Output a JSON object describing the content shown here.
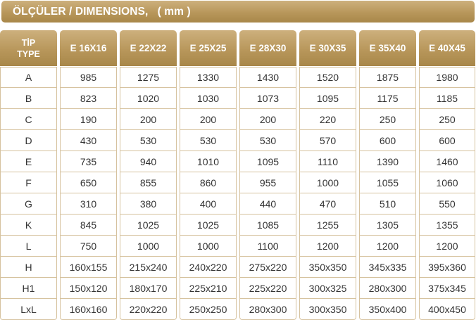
{
  "title": "ÖLÇÜLER / DIMENSIONS,   ( mm )",
  "header": {
    "type_line1": "TİP",
    "type_line2": "TYPE",
    "models": [
      "E 16X16",
      "E 22X22",
      "E 25X25",
      "E 28X30",
      "E 30X35",
      "E 35X40",
      "E 40X45"
    ]
  },
  "rows": [
    {
      "label": "A",
      "values": [
        "985",
        "1275",
        "1330",
        "1430",
        "1520",
        "1875",
        "1980"
      ]
    },
    {
      "label": "B",
      "values": [
        "823",
        "1020",
        "1030",
        "1073",
        "1095",
        "1175",
        "1185"
      ]
    },
    {
      "label": "C",
      "values": [
        "190",
        "200",
        "200",
        "200",
        "220",
        "250",
        "250"
      ]
    },
    {
      "label": "D",
      "values": [
        "430",
        "530",
        "530",
        "530",
        "570",
        "600",
        "600"
      ]
    },
    {
      "label": "E",
      "values": [
        "735",
        "940",
        "1010",
        "1095",
        "1110",
        "1390",
        "1460"
      ]
    },
    {
      "label": "F",
      "values": [
        "650",
        "855",
        "860",
        "955",
        "1000",
        "1055",
        "1060"
      ]
    },
    {
      "label": "G",
      "values": [
        "310",
        "380",
        "400",
        "440",
        "470",
        "510",
        "550"
      ]
    },
    {
      "label": "K",
      "values": [
        "845",
        "1025",
        "1025",
        "1085",
        "1255",
        "1305",
        "1355"
      ]
    },
    {
      "label": "L",
      "values": [
        "750",
        "1000",
        "1000",
        "1100",
        "1200",
        "1200",
        "1200"
      ]
    },
    {
      "label": "H",
      "values": [
        "160x155",
        "215x240",
        "240x220",
        "275x220",
        "350x350",
        "345x335",
        "395x360"
      ]
    },
    {
      "label": "H1",
      "values": [
        "150x120",
        "180x170",
        "225x210",
        "225x220",
        "300x325",
        "280x300",
        "375x345"
      ]
    },
    {
      "label": "LxL",
      "values": [
        "160x160",
        "220x220",
        "250x250",
        "280x300",
        "300x350",
        "350x400",
        "400x450"
      ]
    }
  ],
  "colors": {
    "header_gold": "#b8975b",
    "border": "#d6c29e",
    "text": "#333333"
  }
}
